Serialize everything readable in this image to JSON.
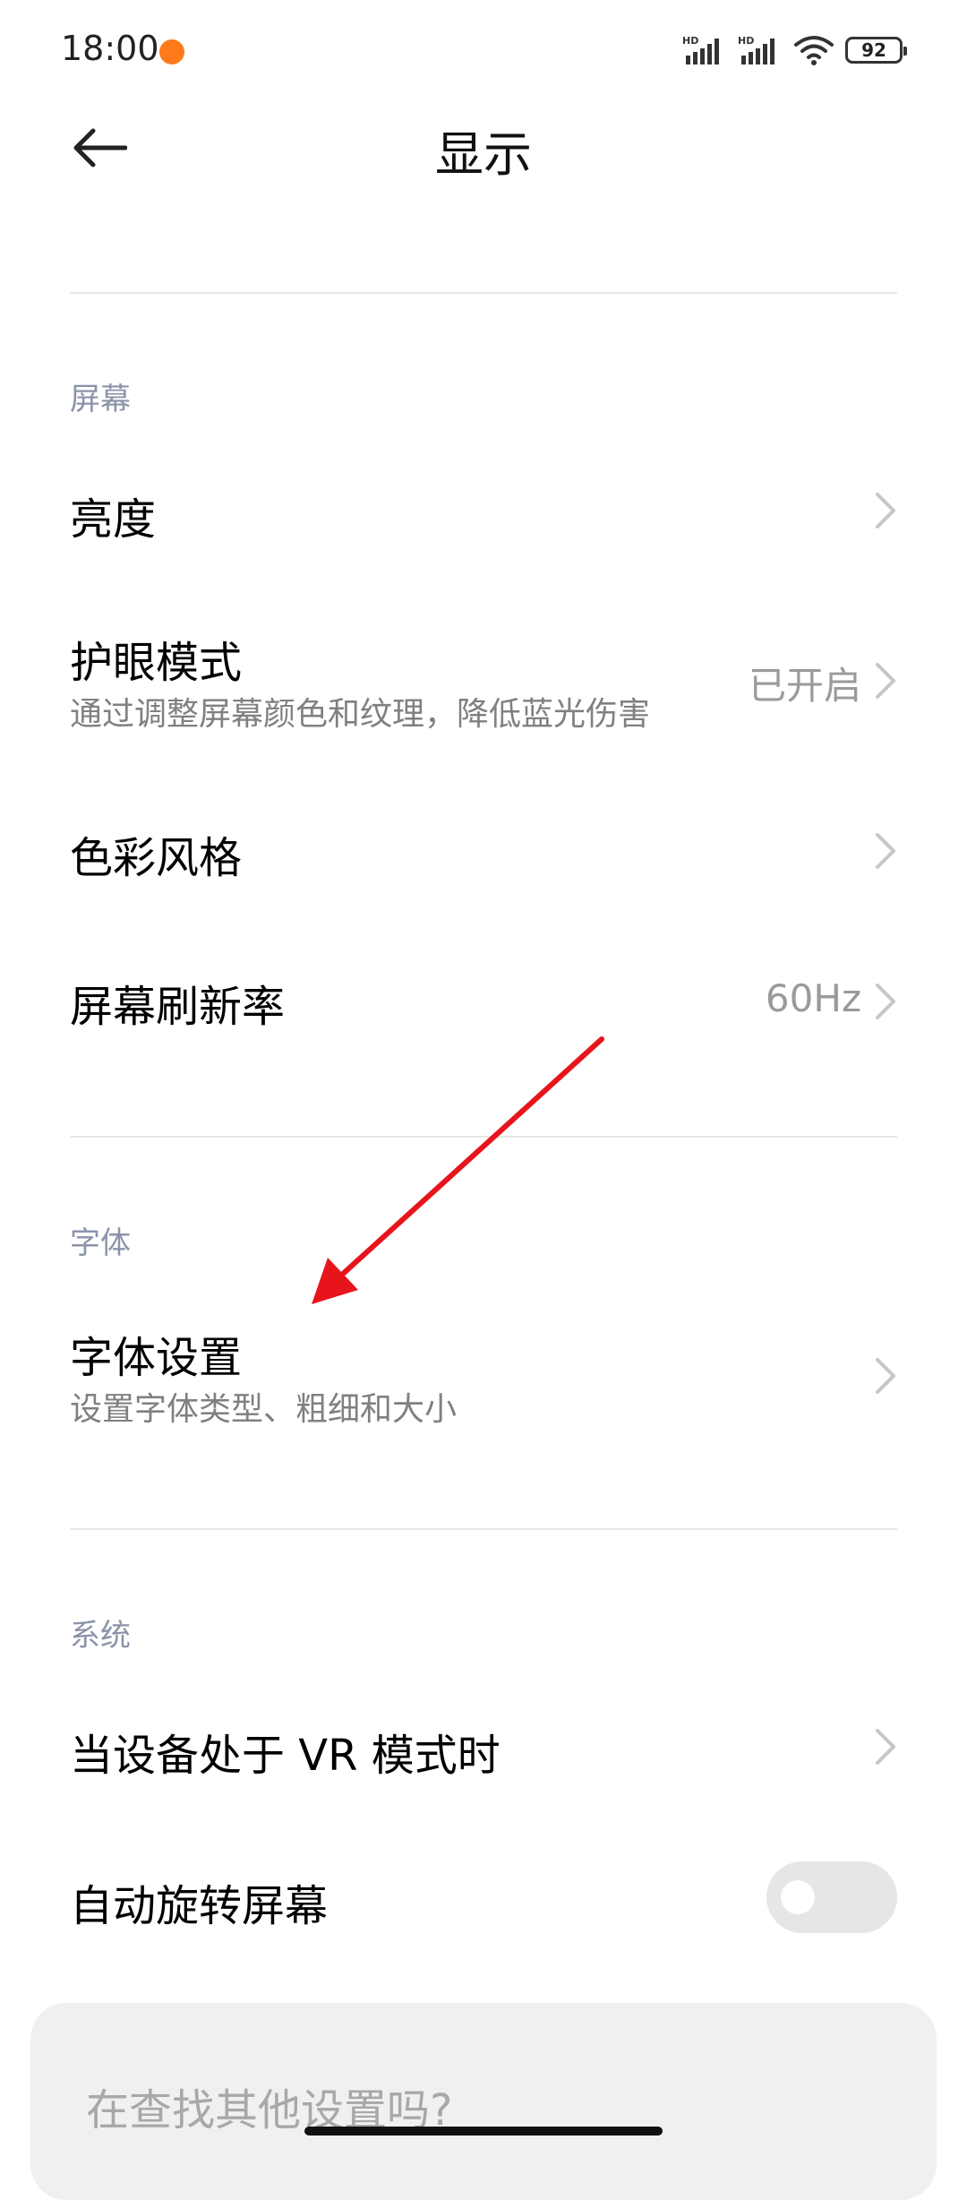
{
  "status_bar": {
    "time": "18:00",
    "battery": "92",
    "signal_label": "HD"
  },
  "header": {
    "title": "显示",
    "back_icon": "arrow-left-icon"
  },
  "sections": {
    "screen": {
      "label": "屏幕",
      "brightness": {
        "title": "亮度"
      },
      "eye_care": {
        "title": "护眼模式",
        "subtitle": "通过调整屏幕颜色和纹理，降低蓝光伤害",
        "value": "已开启"
      },
      "color_style": {
        "title": "色彩风格"
      },
      "refresh_rate": {
        "title": "屏幕刷新率",
        "value": "60Hz"
      }
    },
    "font": {
      "label": "字体",
      "font_settings": {
        "title": "字体设置",
        "subtitle": "设置字体类型、粗细和大小"
      }
    },
    "system": {
      "label": "系统",
      "vr_mode": {
        "title": "当设备处于 VR 模式时"
      },
      "auto_rotate": {
        "title": "自动旋转屏幕",
        "enabled": false
      }
    }
  },
  "search_card": {
    "text": "在查找其他设置吗?"
  },
  "colors": {
    "annotation_arrow": "#e8141c",
    "section_label": "#8a93a8",
    "status_dot": "#ff7a1a"
  }
}
